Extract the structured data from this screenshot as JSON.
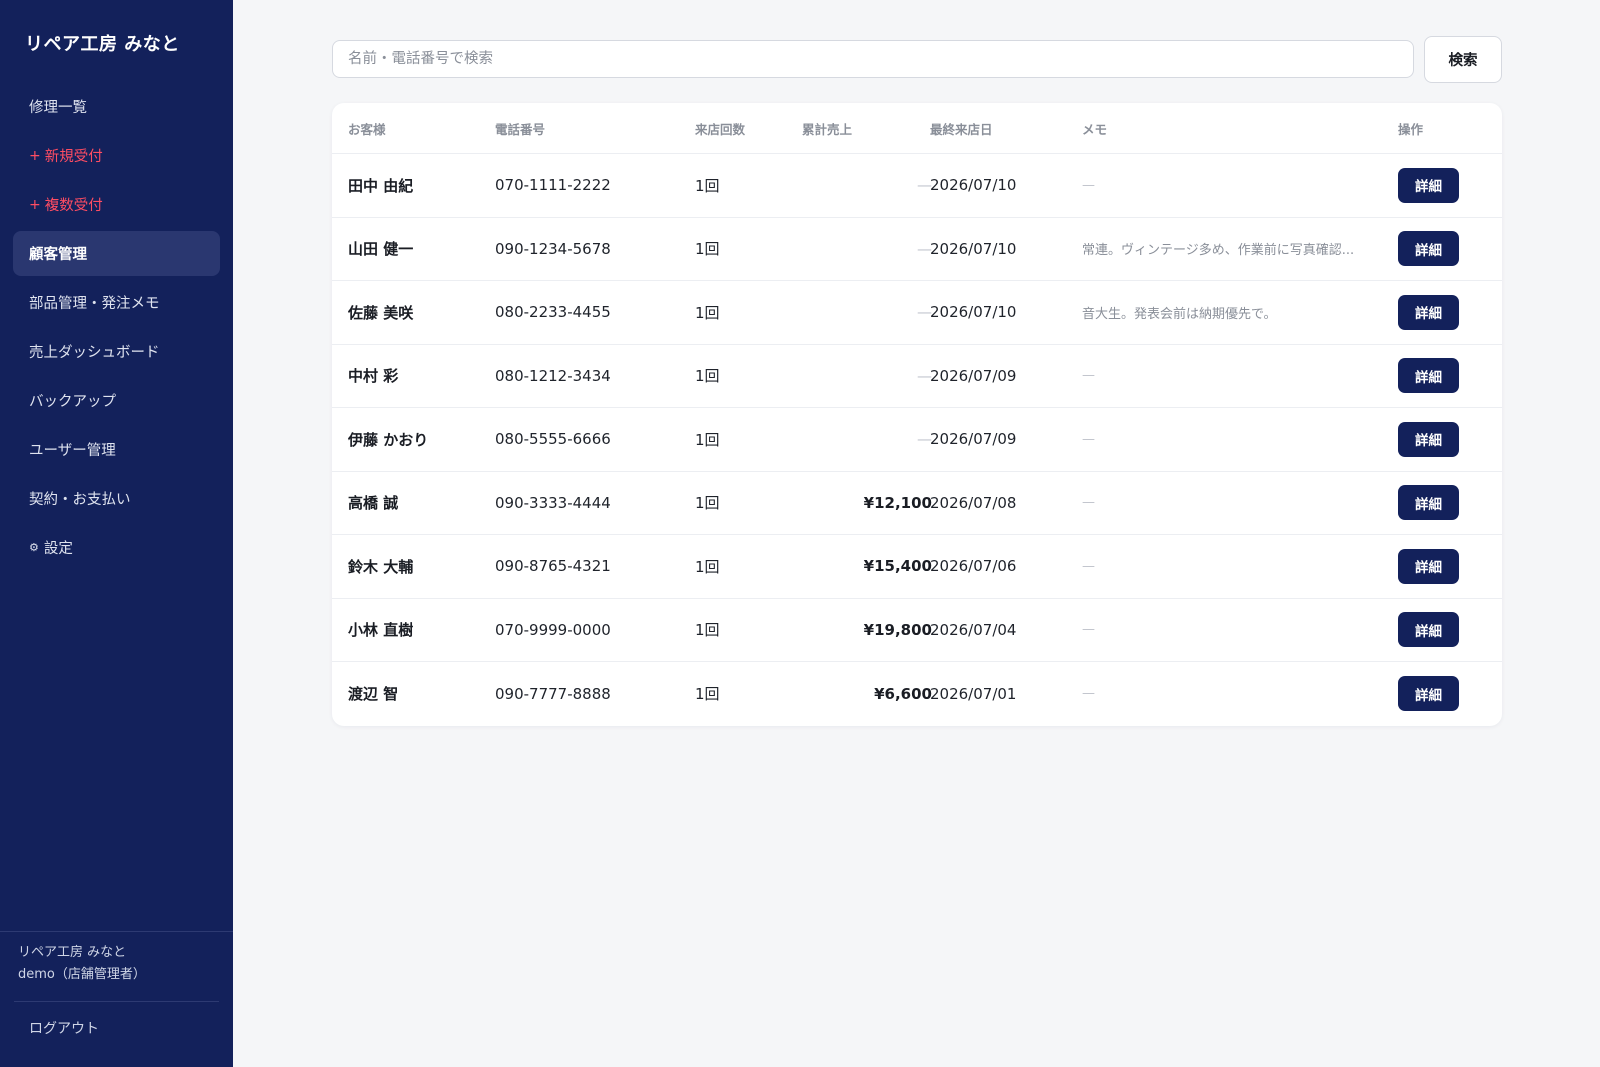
{
  "app": {
    "brand": "リペア工房 みなと"
  },
  "sidebar": {
    "items": [
      {
        "label": "修理一覧",
        "icon": "",
        "style": "normal"
      },
      {
        "label": "新規受付",
        "icon": "plus-icon",
        "glyph": "+",
        "style": "red"
      },
      {
        "label": "複数受付",
        "icon": "plus-icon",
        "glyph": "+",
        "style": "red"
      },
      {
        "label": "顧客管理",
        "icon": "",
        "style": "active"
      },
      {
        "label": "部品管理・発注メモ",
        "icon": "",
        "style": "normal"
      },
      {
        "label": "売上ダッシュボード",
        "icon": "",
        "style": "normal"
      },
      {
        "label": "バックアップ",
        "icon": "",
        "style": "normal"
      },
      {
        "label": "ユーザー管理",
        "icon": "",
        "style": "normal"
      },
      {
        "label": "契約・お支払い",
        "icon": "",
        "style": "normal"
      },
      {
        "label": "設定",
        "icon": "gear-icon",
        "glyph": "⚙",
        "style": "normal"
      }
    ],
    "footer": {
      "store_name": "リペア工房 みなと",
      "user": "demo（店舗管理者）",
      "logout_label": "ログアウト"
    }
  },
  "search": {
    "placeholder": "名前・電話番号で検索",
    "value": "",
    "button_label": "検索"
  },
  "table": {
    "headers": {
      "name": "お客様",
      "phone": "電話番号",
      "visits": "来店回数",
      "sales": "累計売上",
      "last_visit": "最終来店日",
      "memo": "メモ",
      "action": "操作"
    },
    "rows": [
      {
        "name": "田中 由紀",
        "phone": "070-1111-2222",
        "visits": "1回",
        "sales": "—",
        "last_visit": "2026/07/10",
        "memo": "—",
        "action": "詳細"
      },
      {
        "name": "山田 健一",
        "phone": "090-1234-5678",
        "visits": "1回",
        "sales": "—",
        "last_visit": "2026/07/10",
        "memo": "常連。ヴィンテージ多め、作業前に写真確認...",
        "action": "詳細"
      },
      {
        "name": "佐藤 美咲",
        "phone": "080-2233-4455",
        "visits": "1回",
        "sales": "—",
        "last_visit": "2026/07/10",
        "memo": "音大生。発表会前は納期優先で。",
        "action": "詳細"
      },
      {
        "name": "中村 彩",
        "phone": "080-1212-3434",
        "visits": "1回",
        "sales": "—",
        "last_visit": "2026/07/09",
        "memo": "—",
        "action": "詳細"
      },
      {
        "name": "伊藤 かおり",
        "phone": "080-5555-6666",
        "visits": "1回",
        "sales": "—",
        "last_visit": "2026/07/09",
        "memo": "—",
        "action": "詳細"
      },
      {
        "name": "高橋 誠",
        "phone": "090-3333-4444",
        "visits": "1回",
        "sales": "¥12,100",
        "last_visit": "2026/07/08",
        "memo": "—",
        "action": "詳細"
      },
      {
        "name": "鈴木 大輔",
        "phone": "090-8765-4321",
        "visits": "1回",
        "sales": "¥15,400",
        "last_visit": "2026/07/06",
        "memo": "—",
        "action": "詳細"
      },
      {
        "name": "小林 直樹",
        "phone": "070-9999-0000",
        "visits": "1回",
        "sales": "¥19,800",
        "last_visit": "2026/07/04",
        "memo": "—",
        "action": "詳細"
      },
      {
        "name": "渡辺 智",
        "phone": "090-7777-8888",
        "visits": "1回",
        "sales": "¥6,600",
        "last_visit": "2026/07/01",
        "memo": "—",
        "action": "詳細"
      }
    ]
  },
  "colors": {
    "sidebar_bg": "#13215b",
    "sidebar_active": "#2a3770",
    "accent_red": "#ff4d63",
    "button_bg": "#13215b",
    "page_bg": "#f5f6f8"
  }
}
